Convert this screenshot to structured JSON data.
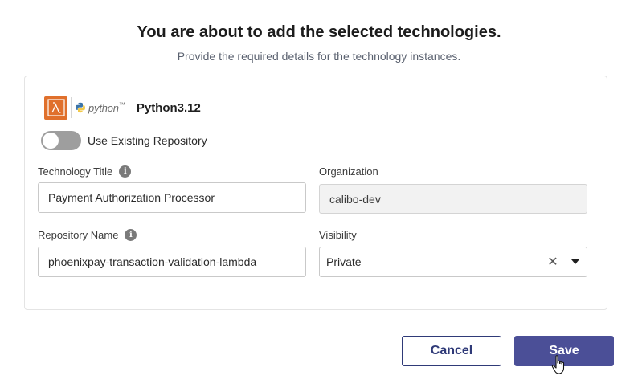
{
  "header": {
    "title": "You are about to add the selected technologies.",
    "subtitle": "Provide the required details for the technology instances."
  },
  "technology": {
    "icons": [
      "aws-lambda-icon",
      "python-logo-icon"
    ],
    "python_word": "python",
    "python_word_suffix": "™",
    "name": "Python3.12"
  },
  "toggle": {
    "label": "Use Existing Repository",
    "state": "off"
  },
  "form": {
    "technology_title": {
      "label": "Technology Title",
      "value": "Payment Authorization Processor"
    },
    "organization": {
      "label": "Organization",
      "value": "calibo-dev"
    },
    "repository_name": {
      "label": "Repository Name",
      "value": "phoenixpay-transaction-validation-lambda"
    },
    "visibility": {
      "label": "Visibility",
      "value": "Private"
    }
  },
  "info_glyph": "i",
  "clear_glyph": "✕",
  "buttons": {
    "cancel": "Cancel",
    "save": "Save"
  },
  "colors": {
    "primary": "#4b4f97",
    "lambda": "#e0702c"
  }
}
